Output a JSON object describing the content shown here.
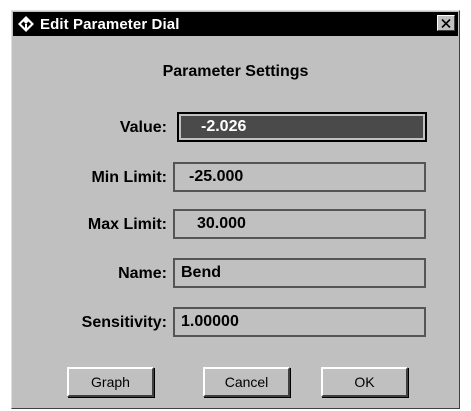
{
  "window": {
    "title": "Edit Parameter Dial",
    "close_glyph": "✕"
  },
  "heading": "Parameter Settings",
  "fields": {
    "value": {
      "label": "Value:",
      "value": "-2.026"
    },
    "min_limit": {
      "label": "Min Limit:",
      "value": "-25.000"
    },
    "max_limit": {
      "label": "Max Limit:",
      "value": "30.000"
    },
    "name": {
      "label": "Name:",
      "value": "Bend"
    },
    "sensitivity": {
      "label": "Sensitivity:",
      "value": "1.00000"
    }
  },
  "buttons": {
    "graph": "Graph",
    "cancel": "Cancel",
    "ok": "OK"
  },
  "colors": {
    "titlebar": "#000000",
    "dialog_bg": "#c0c0c0",
    "active_field_bg": "#4a4a4a"
  }
}
